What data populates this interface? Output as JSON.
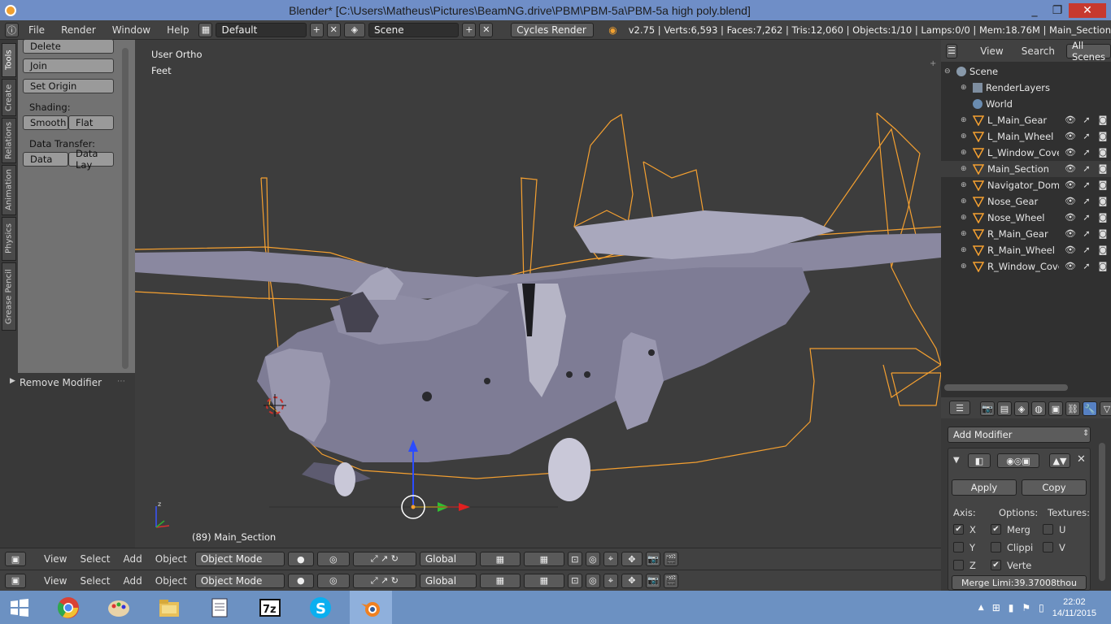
{
  "window": {
    "title": "Blender* [C:\\Users\\Matheus\\Pictures\\BeamNG.drive\\PBM\\PBM-5a\\PBM-5a high poly.blend]",
    "minimize": "_",
    "maximize": "❐",
    "close": "✕"
  },
  "infobar": {
    "menus": [
      "File",
      "Render",
      "Window",
      "Help"
    ],
    "layout": "Default",
    "scene": "Scene",
    "engine": "Cycles Render",
    "stats": "v2.75 | Verts:6,593 | Faces:7,262 | Tris:12,060 | Objects:1/10 | Lamps:0/0 | Mem:18.76M | Main_Section"
  },
  "tool_tabs": [
    "Tools",
    "Create",
    "Relations",
    "Animation",
    "Physics",
    "Grease Pencil"
  ],
  "tools": {
    "delete": "Delete",
    "join": "Join",
    "set_origin": "Set Origin",
    "shading_label": "Shading:",
    "smooth": "Smooth",
    "flat": "Flat",
    "data_transfer_label": "Data Transfer:",
    "data": "Data",
    "data_layout": "Data Lay"
  },
  "last_operator": "Remove Modifier",
  "viewport": {
    "view_name": "User Ortho",
    "units": "Feet",
    "object_info": "(89) Main_Section"
  },
  "outliner": {
    "view_menu": "View",
    "search_menu": "Search",
    "filter": "All Scenes",
    "scene": "Scene",
    "render_layers": "RenderLayers",
    "world": "World",
    "objects": [
      "L_Main_Gear",
      "L_Main_Wheel",
      "L_Window_Cover",
      "Main_Section",
      "Navigator_Dome",
      "Nose_Gear",
      "Nose_Wheel",
      "R_Main_Gear",
      "R_Main_Wheel",
      "R_Window_Cover"
    ],
    "selected": "Main_Section"
  },
  "properties": {
    "add_modifier": "Add Modifier",
    "apply": "Apply",
    "copy": "Copy",
    "axis_label": "Axis:",
    "options_label": "Options:",
    "textures_label": "Textures:",
    "axis": [
      {
        "label": "X",
        "checked": true
      },
      {
        "label": "Y",
        "checked": false
      },
      {
        "label": "Z",
        "checked": false
      }
    ],
    "options": [
      {
        "label": "Merg",
        "checked": true
      },
      {
        "label": "Clippi",
        "checked": false
      },
      {
        "label": "Verte",
        "checked": true
      }
    ],
    "textures": [
      {
        "label": "U",
        "checked": false
      },
      {
        "label": "V",
        "checked": false
      }
    ],
    "merge_limit": "Merge Limi:39.37008thou"
  },
  "headerbar": {
    "view": "View",
    "select": "Select",
    "add": "Add",
    "object": "Object",
    "mode": "Object Mode",
    "orientation": "Global"
  },
  "taskbar": {
    "time": "22:02",
    "date": "14/11/2015"
  },
  "colors": {
    "selection": "#f5a030",
    "titlebar": "#6f8ec7",
    "taskbar": "#6c91c2",
    "active_object": "#f5a030"
  }
}
